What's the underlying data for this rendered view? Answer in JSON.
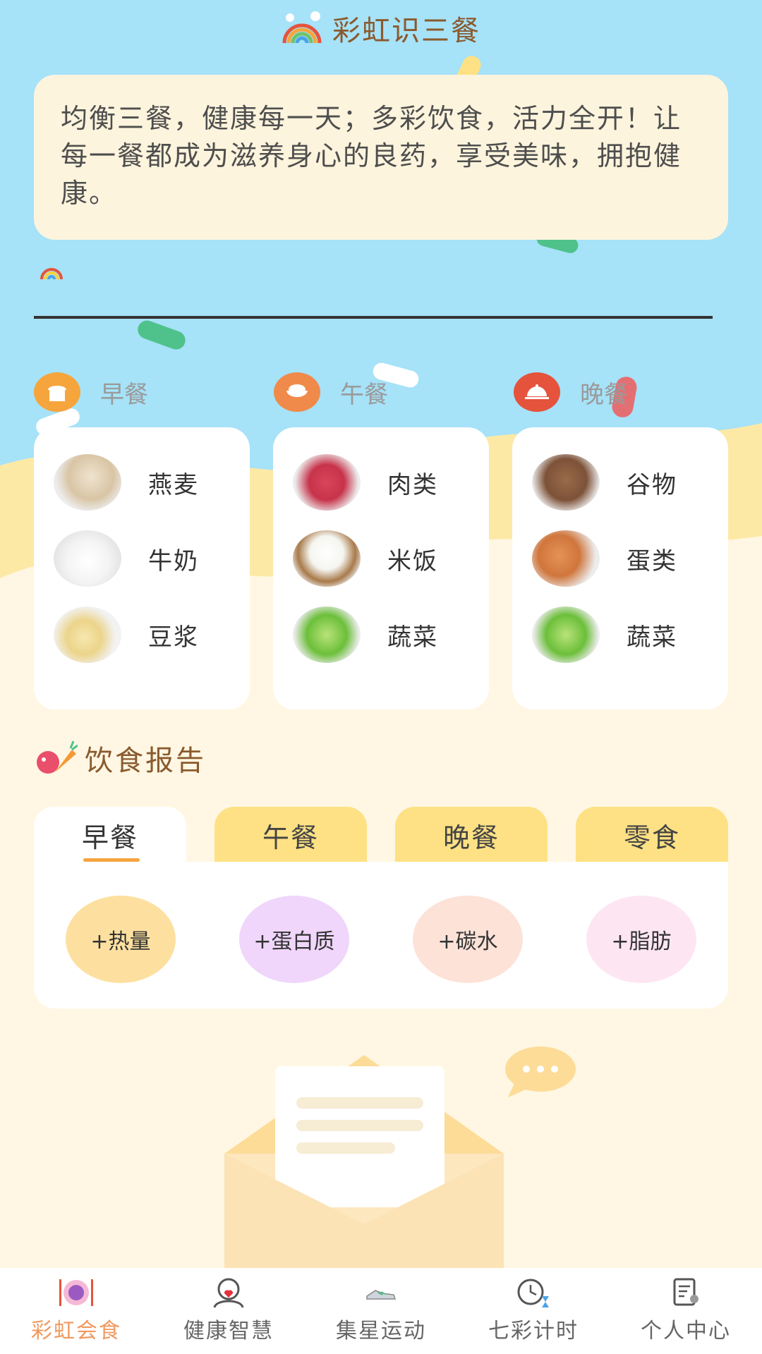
{
  "app": {
    "title": "彩虹识三餐"
  },
  "quote": {
    "text": "均衡三餐，健康每一天；多彩饮食，活力全开！让每一餐都成为滋养身心的良药，享受美味，拥抱健康。"
  },
  "meals": [
    {
      "name": "早餐",
      "icon": "bread-icon",
      "color": "#f6a53c",
      "items": [
        {
          "name": "燕麦",
          "icon": "oats-icon"
        },
        {
          "name": "牛奶",
          "icon": "milk-icon"
        },
        {
          "name": "豆浆",
          "icon": "soymilk-icon"
        }
      ]
    },
    {
      "name": "午餐",
      "icon": "rice-bowl-icon",
      "color": "#f08a4b",
      "items": [
        {
          "name": "肉类",
          "icon": "meat-icon"
        },
        {
          "name": "米饭",
          "icon": "rice-icon"
        },
        {
          "name": "蔬菜",
          "icon": "lettuce-icon"
        }
      ]
    },
    {
      "name": "晚餐",
      "icon": "cloche-icon",
      "color": "#e5533d",
      "items": [
        {
          "name": "谷物",
          "icon": "grain-icon"
        },
        {
          "name": "蛋类",
          "icon": "egg-icon"
        },
        {
          "name": "蔬菜",
          "icon": "lettuce-icon"
        }
      ]
    }
  ],
  "report": {
    "title": "饮食报告",
    "tabs": [
      "早餐",
      "午餐",
      "晚餐",
      "零食"
    ],
    "active_tab": "早餐",
    "nutrients": [
      {
        "label": "+热量",
        "color": "#fde0a0"
      },
      {
        "label": "+蛋白质",
        "color": "#f0d6fb"
      },
      {
        "label": "+碳水",
        "color": "#fde2d8"
      },
      {
        "label": "+脂肪",
        "color": "#fde6f2"
      }
    ]
  },
  "nav": {
    "items": [
      {
        "label": "彩虹会食",
        "icon": "plate-icon",
        "active": true
      },
      {
        "label": "健康智慧",
        "icon": "person-heart-icon",
        "active": false
      },
      {
        "label": "集星运动",
        "icon": "sneaker-icon",
        "active": false
      },
      {
        "label": "七彩计时",
        "icon": "clock-icon",
        "active": false
      },
      {
        "label": "个人中心",
        "icon": "profile-doc-icon",
        "active": false
      }
    ]
  },
  "colors": {
    "sky": "#a6e2f8",
    "cream": "#fff7e3",
    "yellow_band": "#fde9a6",
    "accent": "#f0995f",
    "title_brown": "#8a5a2e"
  }
}
